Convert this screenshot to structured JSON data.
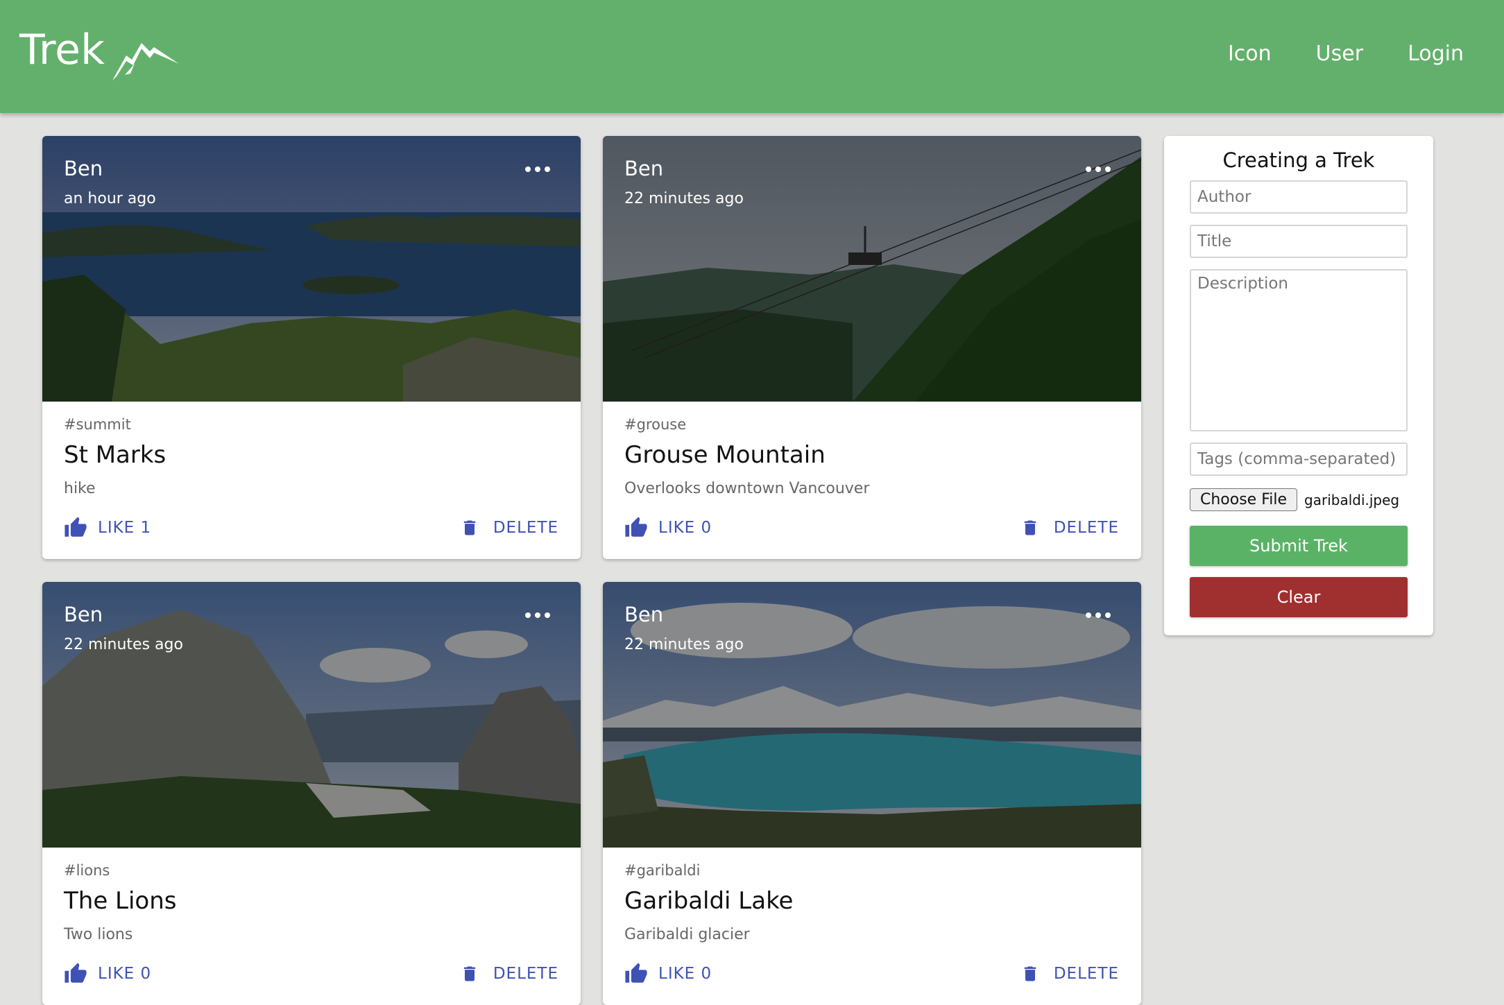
{
  "appbar": {
    "brand": "Trek",
    "nav": [
      "Icon",
      "User",
      "Login"
    ],
    "color": "#63b06c"
  },
  "posts": [
    {
      "author": "Ben",
      "time": "an hour ago",
      "tag": "#summit",
      "title": "St Marks",
      "description": "hike",
      "like_label": "LIKE 1",
      "delete_label": "DELETE",
      "image": "ocean-islands-forest"
    },
    {
      "author": "Ben",
      "time": "22 minutes ago",
      "tag": "#grouse",
      "title": "Grouse Mountain",
      "description": "Overlooks downtown Vancouver",
      "like_label": "LIKE 0",
      "delete_label": "DELETE",
      "image": "gondola-forest-slope"
    },
    {
      "author": "Ben",
      "time": "22 minutes ago",
      "tag": "#lions",
      "title": "The Lions",
      "description": "Two lions",
      "like_label": "LIKE 0",
      "delete_label": "DELETE",
      "image": "rocky-peaks"
    },
    {
      "author": "Ben",
      "time": "22 minutes ago",
      "tag": "#garibaldi",
      "title": "Garibaldi Lake",
      "description": "Garibaldi glacier",
      "like_label": "LIKE 0",
      "delete_label": "DELETE",
      "image": "turquoise-lake-glacier"
    }
  ],
  "form": {
    "heading": "Creating a Trek",
    "author_placeholder": "Author",
    "title_placeholder": "Title",
    "description_placeholder": "Description",
    "tags_placeholder": "Tags (comma-separated)",
    "file_button": "Choose File",
    "file_name": "garibaldi.jpeg",
    "submit_label": "Submit Trek",
    "clear_label": "Clear",
    "submit_color": "#5ab266",
    "clear_color": "#a0302f"
  },
  "accent": "#3f51b5"
}
